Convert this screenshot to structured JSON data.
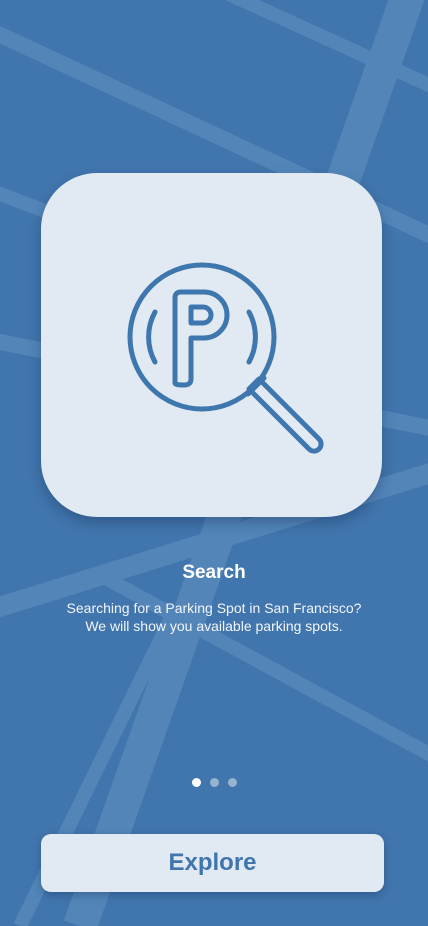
{
  "onboarding": {
    "title": "Search",
    "description_line1": "Searching for a Parking Spot in San Francisco?",
    "description_line2": "We will show you available parking spots.",
    "icon": "parking-search-icon",
    "page_indicator": {
      "total": 3,
      "active_index": 0
    }
  },
  "actions": {
    "explore_label": "Explore"
  },
  "colors": {
    "background": "#4175AD",
    "card": "#E1EAF3",
    "accent": "#3E76AE",
    "map_roads": "#5A8ABD"
  }
}
